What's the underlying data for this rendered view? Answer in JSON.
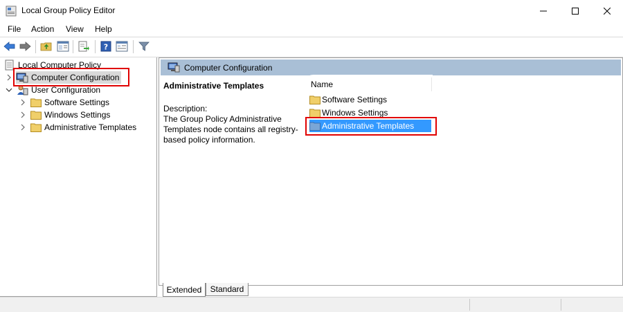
{
  "window": {
    "title": "Local Group Policy Editor",
    "minimize_icon": "minimize-icon",
    "maximize_icon": "maximize-icon",
    "close_icon": "close-icon"
  },
  "menu": {
    "items": [
      "File",
      "Action",
      "View",
      "Help"
    ]
  },
  "toolbar": {
    "icons": [
      "back-arrow-icon",
      "forward-arrow-icon",
      "up-folder-icon",
      "show-hide-tree-icon",
      "export-list-icon",
      "help-icon",
      "properties-icon",
      "filter-icon"
    ]
  },
  "tree": {
    "root": "Local Computer Policy",
    "computer_config": "Computer Configuration",
    "user_config": "User Configuration",
    "children": [
      "Software Settings",
      "Windows Settings",
      "Administrative Templates"
    ]
  },
  "right": {
    "header": "Computer Configuration",
    "selected_title": "Administrative Templates",
    "description_label": "Description:",
    "description_text": "The Group Policy Administrative Templates node contains all registry-based policy information.",
    "column_name": "Name",
    "items": [
      "Software Settings",
      "Windows Settings",
      "Administrative Templates"
    ]
  },
  "tabs": [
    "Extended",
    "Standard"
  ],
  "colors": {
    "highlight": "#e00000",
    "selection": "#3399ff",
    "header_band": "#a9bfd6"
  }
}
